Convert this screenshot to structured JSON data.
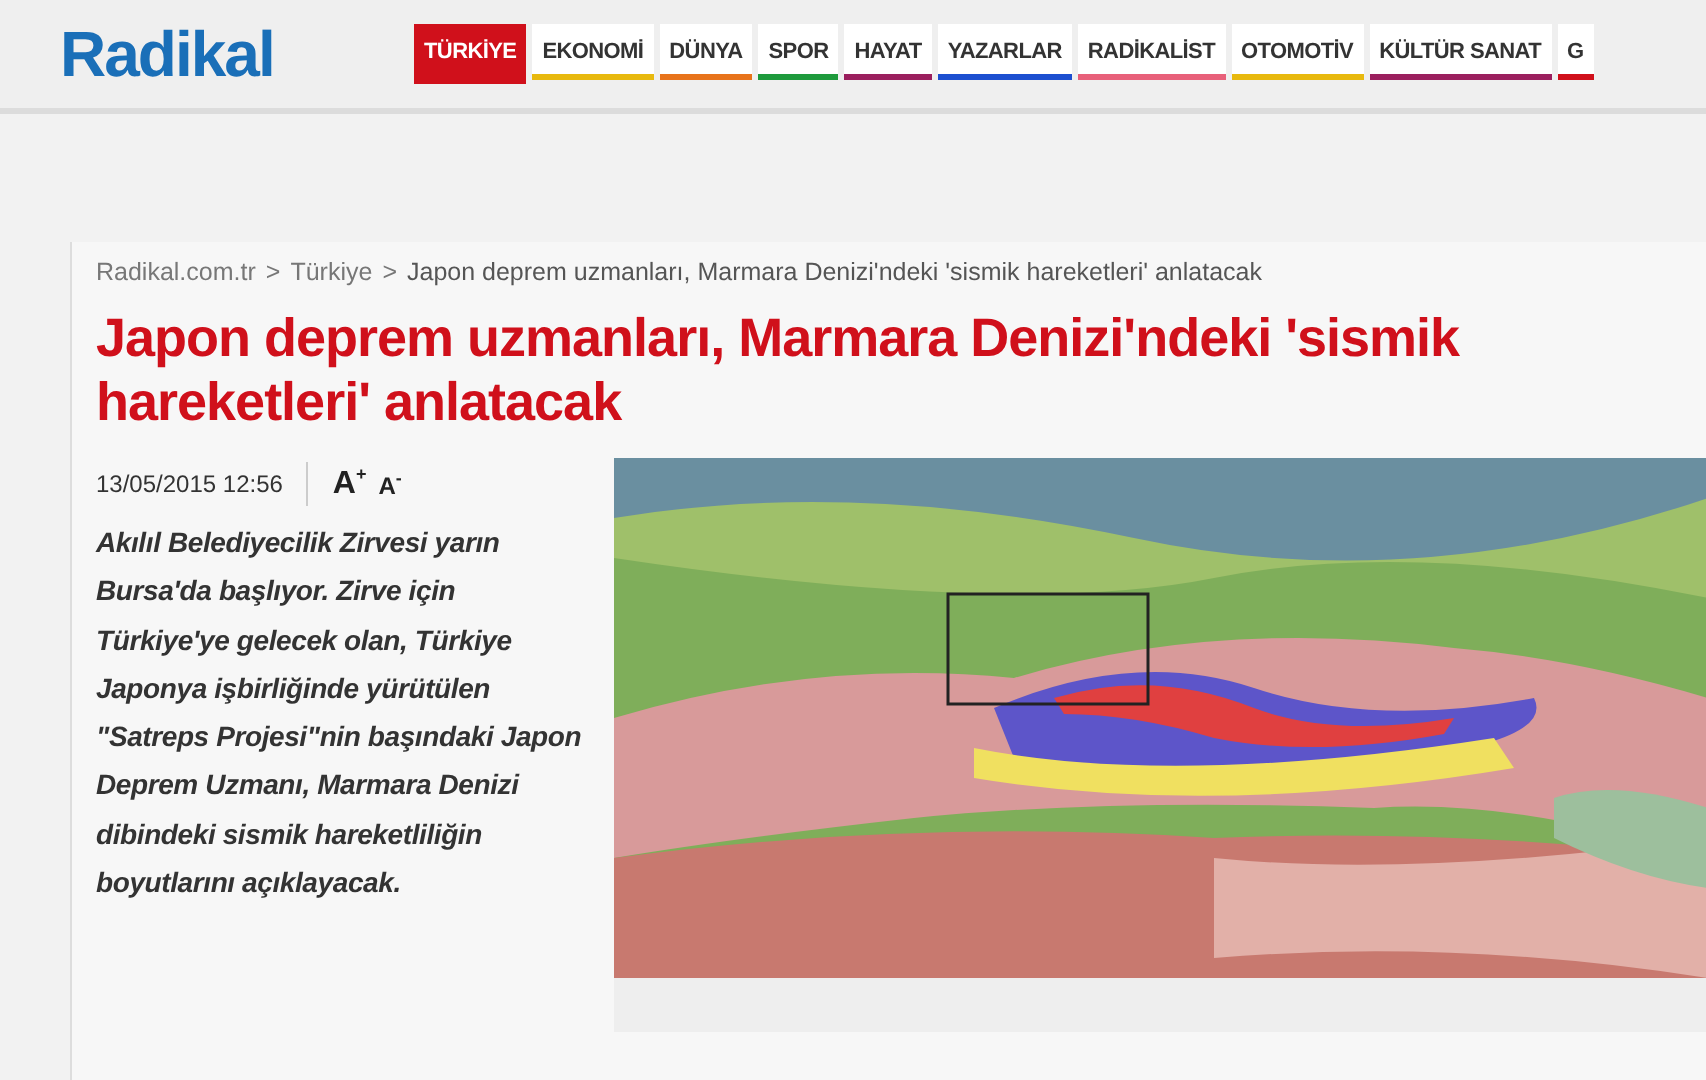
{
  "header": {
    "logo": "Radikal",
    "nav": [
      {
        "label": "TÜRKİYE",
        "selected": true,
        "color": "#d0101b"
      },
      {
        "label": "EKONOMİ",
        "selected": false,
        "color": "#e8b90e"
      },
      {
        "label": "DÜNYA",
        "selected": false,
        "color": "#e8731a"
      },
      {
        "label": "SPOR",
        "selected": false,
        "color": "#1e9a3c"
      },
      {
        "label": "HAYAT",
        "selected": false,
        "color": "#9b1f5e"
      },
      {
        "label": "YAZARLAR",
        "selected": false,
        "color": "#1d4fd0"
      },
      {
        "label": "RADİKALİST",
        "selected": false,
        "color": "#e8607a"
      },
      {
        "label": "OTOMOTİV",
        "selected": false,
        "color": "#e8b90e"
      },
      {
        "label": "KÜLTÜR SANAT",
        "selected": false,
        "color": "#9b1f5e"
      },
      {
        "label": "G",
        "selected": false,
        "color": "#d0101b"
      }
    ]
  },
  "breadcrumb": [
    "Radikal.com.tr",
    "Türkiye",
    "Japon deprem uzmanları, Marmara Denizi'ndeki 'sismik hareketleri' anlatacak"
  ],
  "separator": ">",
  "article": {
    "title": "Japon deprem uzmanları, Marmara Denizi'ndeki 'sismik hareketleri' anlatacak",
    "date": "13/05/2015 12:56",
    "font_buttons": [
      {
        "letter": "A",
        "sign": "+"
      },
      {
        "letter": "A",
        "sign": "-"
      }
    ],
    "summary": "Akılıl Belediyecilik Zirvesi yarın Bursa'da başlıyor. Zirve için Türkiye'ye gelecek olan, Türkiye Japonya işbirliğinde yürütülen \"Satreps Projesi\"nin başındaki Japon Deprem Uzmanı, Marmara Denizi dibindeki sismik hareketliliğin boyutlarını açıklayacak."
  }
}
